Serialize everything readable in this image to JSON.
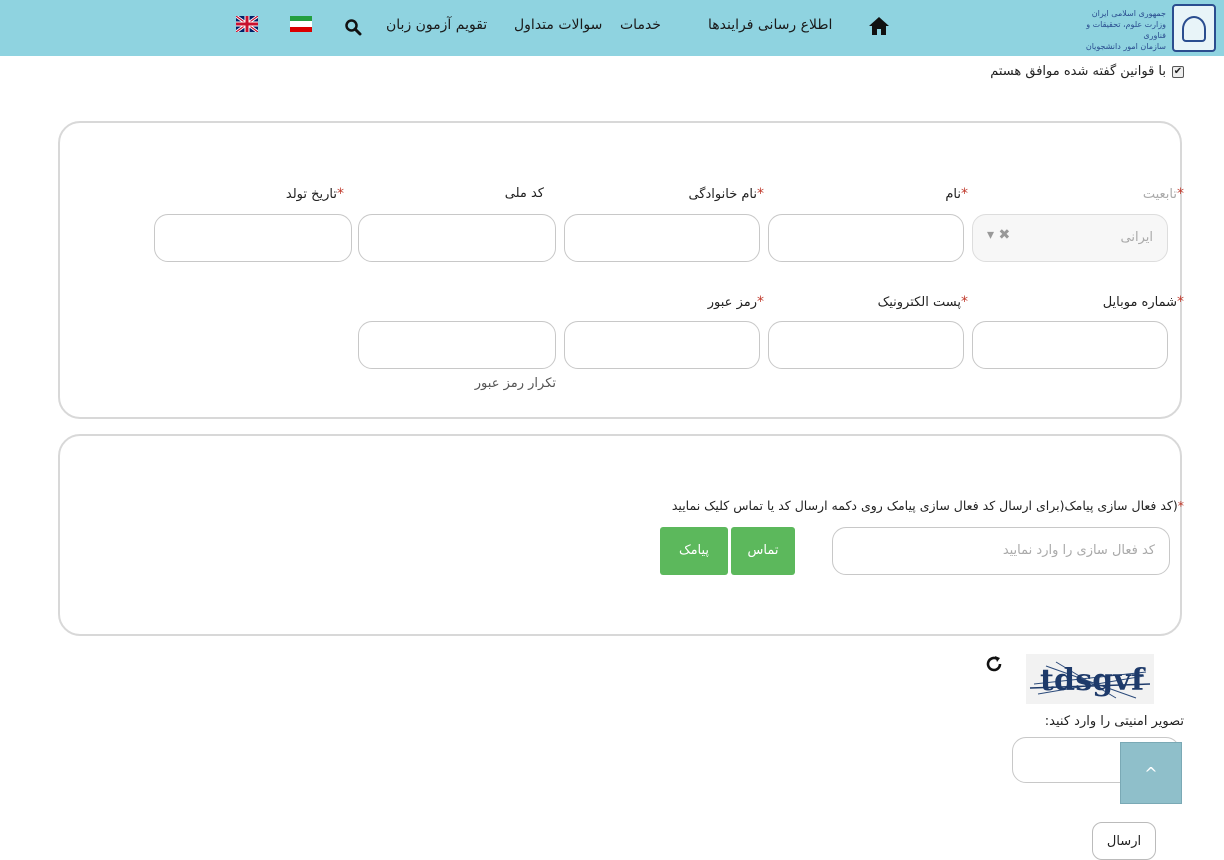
{
  "header": {
    "logo_lines": [
      "جمهوری اسلامی ایران",
      "وزارت علوم، تحقیقات و فناوری",
      "سازمان امور دانشجویان"
    ],
    "nav": [
      "اطلاع رسانی فرایندها",
      "خدمات",
      "سوالات متداول",
      "تقویم آزمون زبان"
    ],
    "icons": [
      "home-icon",
      "search-icon",
      "iran-flag-icon",
      "uk-flag-icon"
    ]
  },
  "agreement": {
    "label": "با قوانین گفته شده موافق هستم",
    "checked": true
  },
  "personal": {
    "nationality_label": "تابعیت",
    "nationality_value": "ایرانی",
    "first_name_label": "نام",
    "last_name_label": "نام خانوادگی",
    "national_code_label": "کد ملی",
    "birth_date_label": "تاریخ تولد",
    "mobile_label": "شماره موبایل",
    "email_label": "پست الکترونیک",
    "password_label": "رمز عبور",
    "password_repeat_hint": "تکرار رمز عبور"
  },
  "sms": {
    "label": "(کد فعال سازی پیامک(برای ارسال کد فعال سازی پیامک روی دکمه ارسال کد یا تماس کلیک نمایید",
    "placeholder": "کد فعال سازی را وارد نمایید",
    "call_button": "تماس",
    "sms_button": "پیامک"
  },
  "captcha": {
    "text": "tdsgvf",
    "label": "تصویر امنیتی را وارد کنید:"
  },
  "submit_label": "ارسال",
  "colors": {
    "navbar": "#8fd3e0",
    "required": "#c0392b",
    "green_button": "#5cb85c"
  }
}
